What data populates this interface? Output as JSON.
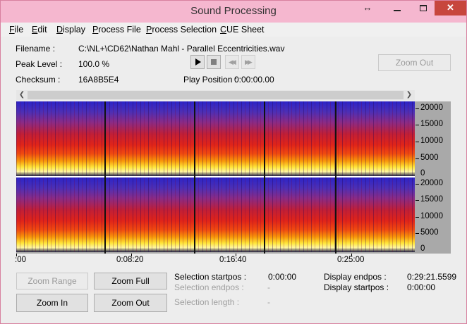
{
  "window": {
    "title": "Sound Processing",
    "controls": {
      "resize": "↔",
      "close": "✕"
    }
  },
  "menu": [
    {
      "acc": "F",
      "rest": "ile"
    },
    {
      "acc": "E",
      "rest": "dit"
    },
    {
      "acc": "D",
      "rest": "isplay"
    },
    {
      "acc": "P",
      "rest": "rocess File"
    },
    {
      "acc": "P",
      "rest": "rocess Selection"
    },
    {
      "acc": "C",
      "rest": "UE Sheet"
    }
  ],
  "info": {
    "filename_label": "Filename :",
    "filename_value": "C:\\NL+\\CD62\\Nathan Mahl - Parallel Eccentricities.wav",
    "peak_label": "Peak Level :",
    "peak_value": "100.0 %",
    "checksum_label": "Checksum :",
    "checksum_value": "16A8B5E4",
    "play_position_label": "Play Position :",
    "play_position_value": "0:00:00.00"
  },
  "transport": {
    "play_icon": "play-icon",
    "stop_icon": "stop-icon",
    "rewind_glyph": "◀◀",
    "forward_glyph": "▶▶"
  },
  "zoom_out_top_label": "Zoom Out",
  "spectrogram": {
    "y_ticks": [
      "20000",
      "15000",
      "10000",
      "5000",
      "0"
    ],
    "x_ticks": [
      ":00",
      "0:08:20",
      "0:16:40",
      "0:25:00"
    ]
  },
  "buttons": {
    "zoom_range": "Zoom Range",
    "zoom_full": "Zoom Full",
    "zoom_in": "Zoom In",
    "zoom_out": "Zoom Out"
  },
  "selection": {
    "startpos_label": "Selection startpos :",
    "startpos_value": "0:00:00",
    "endpos_label": "Selection endpos :",
    "endpos_value": "-",
    "length_label": "Selection length :",
    "length_value": "-"
  },
  "display": {
    "endpos_label": "Display endpos :",
    "endpos_value": "0:29:21.5599",
    "startpos_label": "Display startpos :",
    "startpos_value": "0:00:00"
  }
}
